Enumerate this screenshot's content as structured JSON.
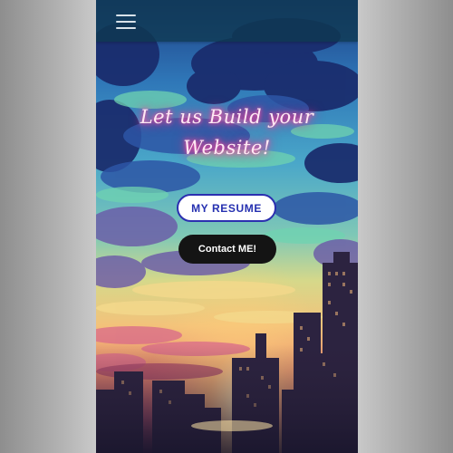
{
  "header": {
    "menu_icon": "hamburger-menu-icon"
  },
  "hero": {
    "headline_line1": "Let us Build your",
    "headline_line2": "Website!",
    "resume_label": "MY RESUME",
    "contact_label": "Contact ME!"
  },
  "colors": {
    "headline_glow": "#ff4fa8",
    "resume_border": "#2b2fb0",
    "resume_text": "#2530b0",
    "contact_bg": "#141414",
    "topbar_bg": "#0e3850"
  }
}
